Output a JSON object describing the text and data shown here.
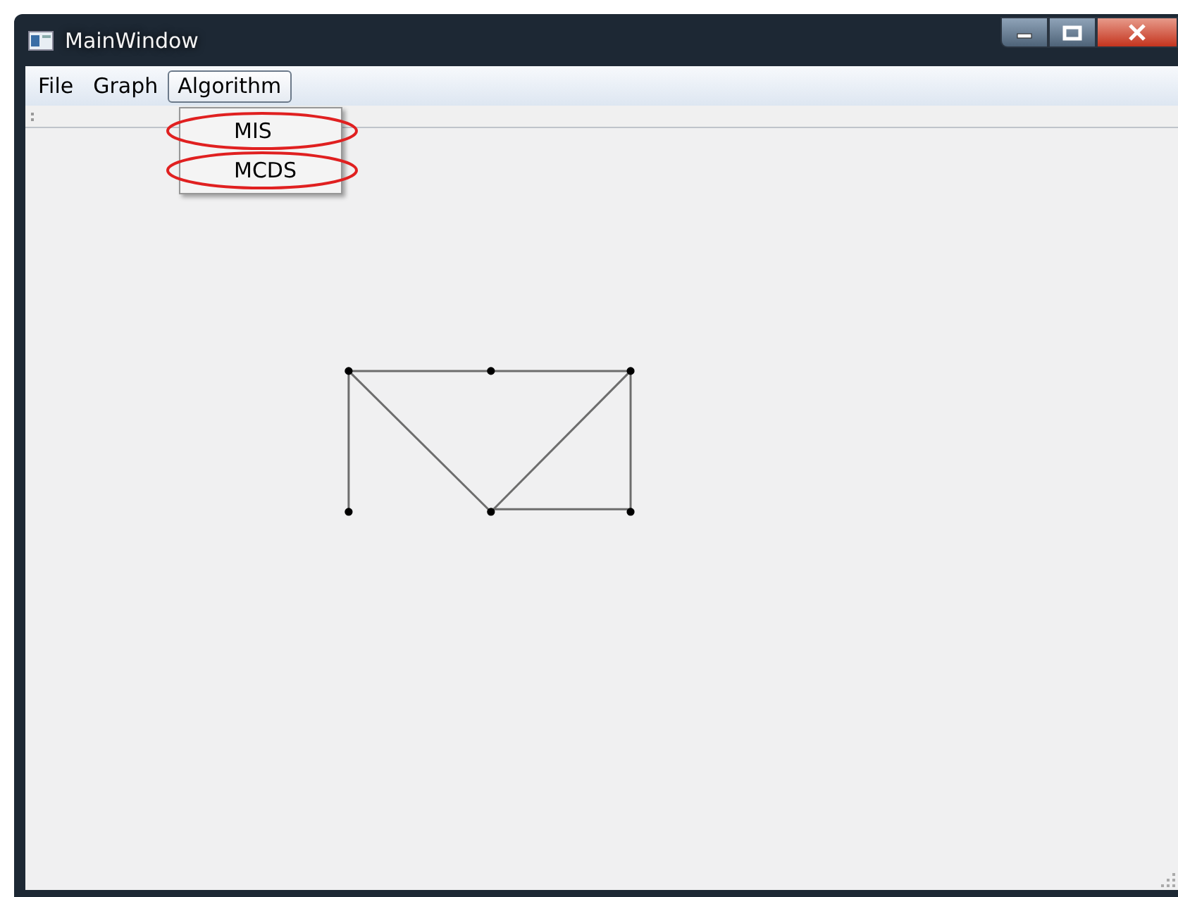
{
  "window": {
    "title": "MainWindow"
  },
  "menu_bar": [
    {
      "label": "File",
      "selected": false
    },
    {
      "label": "Graph",
      "selected": false
    },
    {
      "label": "Algorithm",
      "selected": true
    }
  ],
  "open_menu": {
    "items": [
      {
        "label": "MIS",
        "circled": true
      },
      {
        "label": "MCDS",
        "circled": true
      }
    ]
  }
}
